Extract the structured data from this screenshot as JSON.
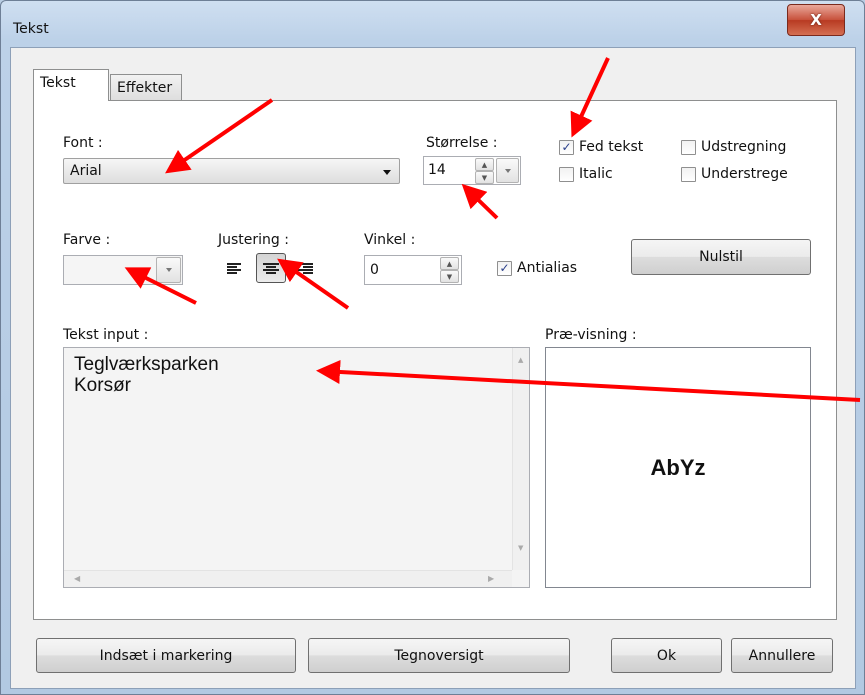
{
  "window": {
    "title": "Tekst",
    "close_glyph": "X"
  },
  "tabs": [
    {
      "label": "Tekst"
    },
    {
      "label": "Effekter"
    }
  ],
  "font": {
    "label": "Font :",
    "value": "Arial"
  },
  "size": {
    "label": "Størrelse :",
    "value": "14"
  },
  "checkboxes": {
    "bold": {
      "label": "Fed tekst",
      "checked": true
    },
    "italic": {
      "label": "Italic",
      "checked": false
    },
    "strike": {
      "label": "Udstregning",
      "checked": false
    },
    "underline": {
      "label": "Understrege",
      "checked": false
    },
    "antialias": {
      "label": "Antialias",
      "checked": true
    }
  },
  "color": {
    "label": "Farve :",
    "value": ""
  },
  "alignment": {
    "label": "Justering :",
    "options": [
      "left",
      "center",
      "right"
    ],
    "selected": "center"
  },
  "angle": {
    "label": "Vinkel :",
    "value": "0"
  },
  "reset_button": "Nulstil",
  "text_input": {
    "label": "Tekst input :",
    "value": "Teglværksparken\nKorsør"
  },
  "preview": {
    "label": "Præ-visning :",
    "sample": "AbYz"
  },
  "footer": {
    "insert": "Indsæt i markering",
    "charmap": "Tegnoversigt",
    "ok": "Ok",
    "cancel": "Annullere"
  },
  "colors": {
    "annotation_arrow": "#ff0000",
    "check": "#2a3e8a"
  }
}
